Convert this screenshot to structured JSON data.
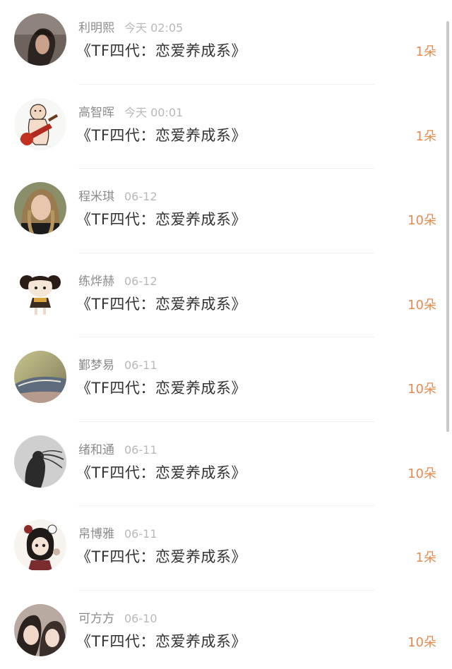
{
  "gift_list": {
    "items": [
      {
        "username": "利明熙",
        "time": "今天 02:05",
        "gift": "《TF四代：恋爱养成系》",
        "count": "1朵",
        "avatar": "avatar-1"
      },
      {
        "username": "高智晖",
        "time": "今天 00:01",
        "gift": "《TF四代：恋爱养成系》",
        "count": "1朵",
        "avatar": "avatar-2"
      },
      {
        "username": "程米琪",
        "time": "06-12",
        "gift": "《TF四代：恋爱养成系》",
        "count": "10朵",
        "avatar": "avatar-3"
      },
      {
        "username": "练烨赫",
        "time": "06-12",
        "gift": "《TF四代：恋爱养成系》",
        "count": "10朵",
        "avatar": "avatar-4"
      },
      {
        "username": "鄞梦易",
        "time": "06-11",
        "gift": "《TF四代：恋爱养成系》",
        "count": "10朵",
        "avatar": "avatar-5"
      },
      {
        "username": "绪和通",
        "time": "06-11",
        "gift": "《TF四代：恋爱养成系》",
        "count": "10朵",
        "avatar": "avatar-6"
      },
      {
        "username": "帛博雅",
        "time": "06-11",
        "gift": "《TF四代：恋爱养成系》",
        "count": "1朵",
        "avatar": "avatar-7"
      },
      {
        "username": "可方方",
        "time": "06-10",
        "gift": "《TF四代：恋爱养成系》",
        "count": "10朵",
        "avatar": "avatar-8"
      }
    ]
  },
  "colors": {
    "username": "#8b8b8b",
    "time": "#b8b8b8",
    "title": "#333333",
    "count_accent": "#e68a4e",
    "divider": "#efefef"
  }
}
